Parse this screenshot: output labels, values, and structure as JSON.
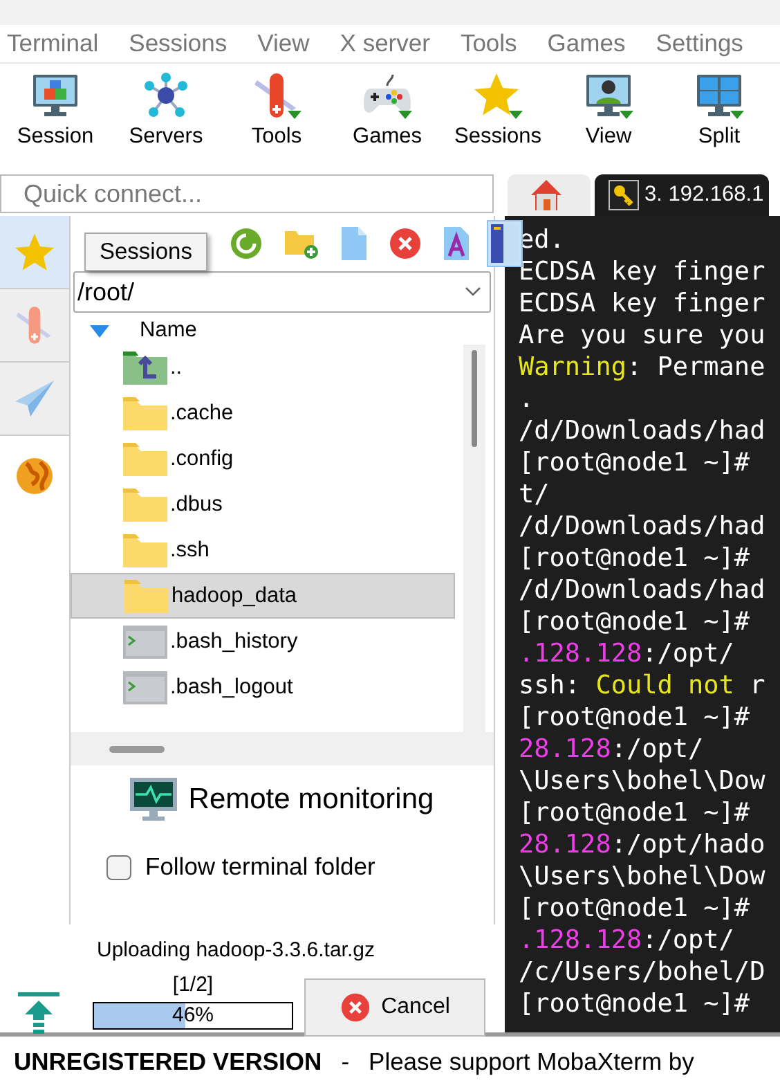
{
  "menu": [
    {
      "label": "Terminal"
    },
    {
      "label": "Sessions"
    },
    {
      "label": "View"
    },
    {
      "label": "X server"
    },
    {
      "label": "Tools"
    },
    {
      "label": "Games"
    },
    {
      "label": "Settings"
    }
  ],
  "toolbar": [
    {
      "label": "Session",
      "kind": "session"
    },
    {
      "label": "Servers",
      "kind": "servers"
    },
    {
      "label": "Tools",
      "kind": "tools"
    },
    {
      "label": "Games",
      "kind": "games"
    },
    {
      "label": "Sessions",
      "kind": "sessions"
    },
    {
      "label": "View",
      "kind": "view"
    },
    {
      "label": "Split",
      "kind": "split"
    }
  ],
  "quick_connect": {
    "placeholder": "Quick connect..."
  },
  "tabs": [
    {
      "kind": "home",
      "selected": false
    },
    {
      "kind": "session",
      "label": "3. 192.168.1",
      "selected": true
    }
  ],
  "sidebar": [
    {
      "kind": "star",
      "selected": true
    },
    {
      "kind": "tools",
      "selected": false
    },
    {
      "kind": "send",
      "selected": false
    },
    {
      "kind": "globe",
      "selected": false
    }
  ],
  "tooltip": "Sessions",
  "file_panel": {
    "tools": [
      {
        "kind": "refresh",
        "selected": false
      },
      {
        "kind": "new-folder",
        "selected": false
      },
      {
        "kind": "new-file",
        "selected": false
      },
      {
        "kind": "delete",
        "selected": false
      },
      {
        "kind": "rename",
        "selected": false
      },
      {
        "kind": "panel",
        "selected": true
      }
    ],
    "path": "/root/",
    "column": "Name",
    "rows": [
      {
        "name": "..",
        "kind": "up",
        "selected": false
      },
      {
        "name": ".cache",
        "kind": "folder",
        "selected": false
      },
      {
        "name": ".config",
        "kind": "folder",
        "selected": false
      },
      {
        "name": ".dbus",
        "kind": "folder",
        "selected": false
      },
      {
        "name": ".ssh",
        "kind": "folder",
        "selected": false
      },
      {
        "name": "hadoop_data",
        "kind": "folder",
        "selected": true
      },
      {
        "name": ".bash_history",
        "kind": "file",
        "selected": false
      },
      {
        "name": ".bash_logout",
        "kind": "file",
        "selected": false
      }
    ],
    "remote_monitoring": "Remote monitoring",
    "follow": {
      "label": "Follow terminal folder",
      "checked": false
    }
  },
  "upload": {
    "text": "Uploading hadoop-3.3.6.tar.gz",
    "count": "[1/2]",
    "level": 0.46,
    "percent": "46%",
    "cancel": "Cancel"
  },
  "terminal": {
    "lines": [
      [
        {
          "text": "ed.",
          "kind": "plain"
        }
      ],
      [
        {
          "text": "ECDSA key finger",
          "kind": "plain"
        }
      ],
      [
        {
          "text": "ECDSA key finger",
          "kind": "plain"
        }
      ],
      [
        {
          "text": "Are you sure you",
          "kind": "plain"
        }
      ],
      [
        {
          "text": "Warning",
          "kind": "warning"
        },
        {
          "text": ": Permane",
          "kind": "plain"
        }
      ],
      [
        {
          "text": ".",
          "kind": "plain"
        }
      ],
      [
        {
          "text": "/d/Downloads/had",
          "kind": "plain"
        }
      ],
      [
        {
          "text": "[root@node1 ~]#",
          "kind": "plain"
        }
      ],
      [
        {
          "text": "t/",
          "kind": "plain"
        }
      ],
      [
        {
          "text": "/d/Downloads/had",
          "kind": "plain"
        }
      ],
      [
        {
          "text": "[root@node1 ~]#",
          "kind": "plain"
        }
      ],
      [
        {
          "text": "/d/Downloads/had",
          "kind": "plain"
        }
      ],
      [
        {
          "text": "[root@node1 ~]#",
          "kind": "plain"
        }
      ],
      [
        {
          "text": ".128.128",
          "kind": "host"
        },
        {
          "text": ":/opt/",
          "kind": "plain"
        }
      ],
      [
        {
          "text": "ssh: ",
          "kind": "plain"
        },
        {
          "text": "Could not",
          "kind": "warning"
        },
        {
          "text": " r",
          "kind": "plain"
        }
      ],
      [
        {
          "text": "[root@node1 ~]#",
          "kind": "plain"
        }
      ],
      [
        {
          "text": "28.128",
          "kind": "host"
        },
        {
          "text": ":/opt/",
          "kind": "plain"
        }
      ],
      [
        {
          "text": "\\Users\\bohel\\Dow",
          "kind": "plain"
        }
      ],
      [
        {
          "text": "[root@node1 ~]#",
          "kind": "plain"
        }
      ],
      [
        {
          "text": "28.128",
          "kind": "host"
        },
        {
          "text": ":/opt/hado",
          "kind": "plain"
        }
      ],
      [
        {
          "text": "\\Users\\bohel\\Dow",
          "kind": "plain"
        }
      ],
      [
        {
          "text": "[root@node1 ~]#",
          "kind": "plain"
        }
      ],
      [
        {
          "text": ".128.128",
          "kind": "host"
        },
        {
          "text": ":/opt/",
          "kind": "plain"
        }
      ],
      [
        {
          "text": "/c/Users/bohel/D",
          "kind": "plain"
        }
      ],
      [
        {
          "text": "[root@node1 ~]#",
          "kind": "plain"
        }
      ]
    ]
  },
  "status_bar": {
    "edition": "UNREGISTERED VERSION",
    "separator": "-",
    "message": "Please support MobaXterm by"
  }
}
